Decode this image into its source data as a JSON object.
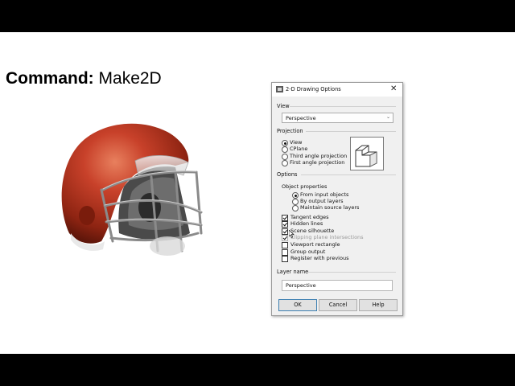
{
  "command": {
    "label": "Command:",
    "value": "Make2D"
  },
  "dialog": {
    "title": "2-D Drawing Options",
    "close_glyph": "✕",
    "view": {
      "group_label": "View",
      "selected": "Perspective",
      "chevron": "⌄"
    },
    "projection": {
      "group_label": "Projection",
      "options": [
        {
          "label": "View",
          "checked": true
        },
        {
          "label": "CPlane",
          "checked": false
        },
        {
          "label": "Third angle projection",
          "checked": false
        },
        {
          "label": "First angle projection",
          "checked": false
        }
      ]
    },
    "options": {
      "group_label": "Options",
      "object_properties_label": "Object properties",
      "object_properties": [
        {
          "label": "From input objects",
          "checked": true
        },
        {
          "label": "By output layers",
          "checked": false
        },
        {
          "label": "Maintain source layers",
          "checked": false
        }
      ],
      "checkboxes": [
        {
          "label": "Tangent edges",
          "checked": true,
          "disabled": false
        },
        {
          "label": "Hidden lines",
          "checked": true,
          "disabled": false
        },
        {
          "label": "Scene silhouette",
          "checked": true,
          "disabled": false
        },
        {
          "label": "Clipping plane intersections",
          "checked": true,
          "disabled": true
        },
        {
          "label": "Viewport rectangle",
          "checked": false,
          "disabled": false
        },
        {
          "label": "Group output",
          "checked": false,
          "disabled": false
        },
        {
          "label": "Register with previous",
          "checked": false,
          "disabled": false
        }
      ]
    },
    "layer_name": {
      "group_label": "Layer name",
      "value": "Perspective"
    },
    "buttons": {
      "ok": "OK",
      "cancel": "Cancel",
      "help": "Help"
    }
  }
}
